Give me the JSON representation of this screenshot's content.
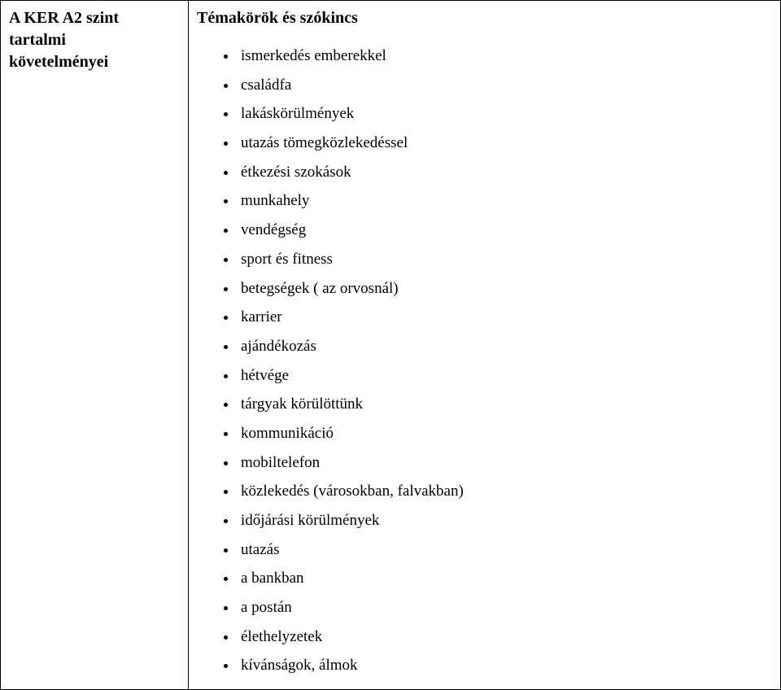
{
  "left_cell": {
    "line1": "A KER A2 szint",
    "line2": "tartalmi",
    "line3": "követelményei"
  },
  "right_cell": {
    "heading": "Témakörök és szókincs",
    "items": [
      "ismerkedés emberekkel",
      "családfa",
      "lakáskörülmények",
      "utazás tömegközlekedéssel",
      "étkezési szokások",
      "munkahely",
      "vendégség",
      "sport és fitness",
      "betegségek ( az orvosnál)",
      "karrier",
      "ajándékozás",
      "hétvége",
      "tárgyak körülöttünk",
      "kommunikáció",
      "mobiltelefon",
      "közlekedés (városokban, falvakban)",
      "időjárási körülmények",
      "utazás",
      "a bankban",
      "a postán",
      "élethelyzetek",
      "kívánságok, álmok"
    ]
  }
}
